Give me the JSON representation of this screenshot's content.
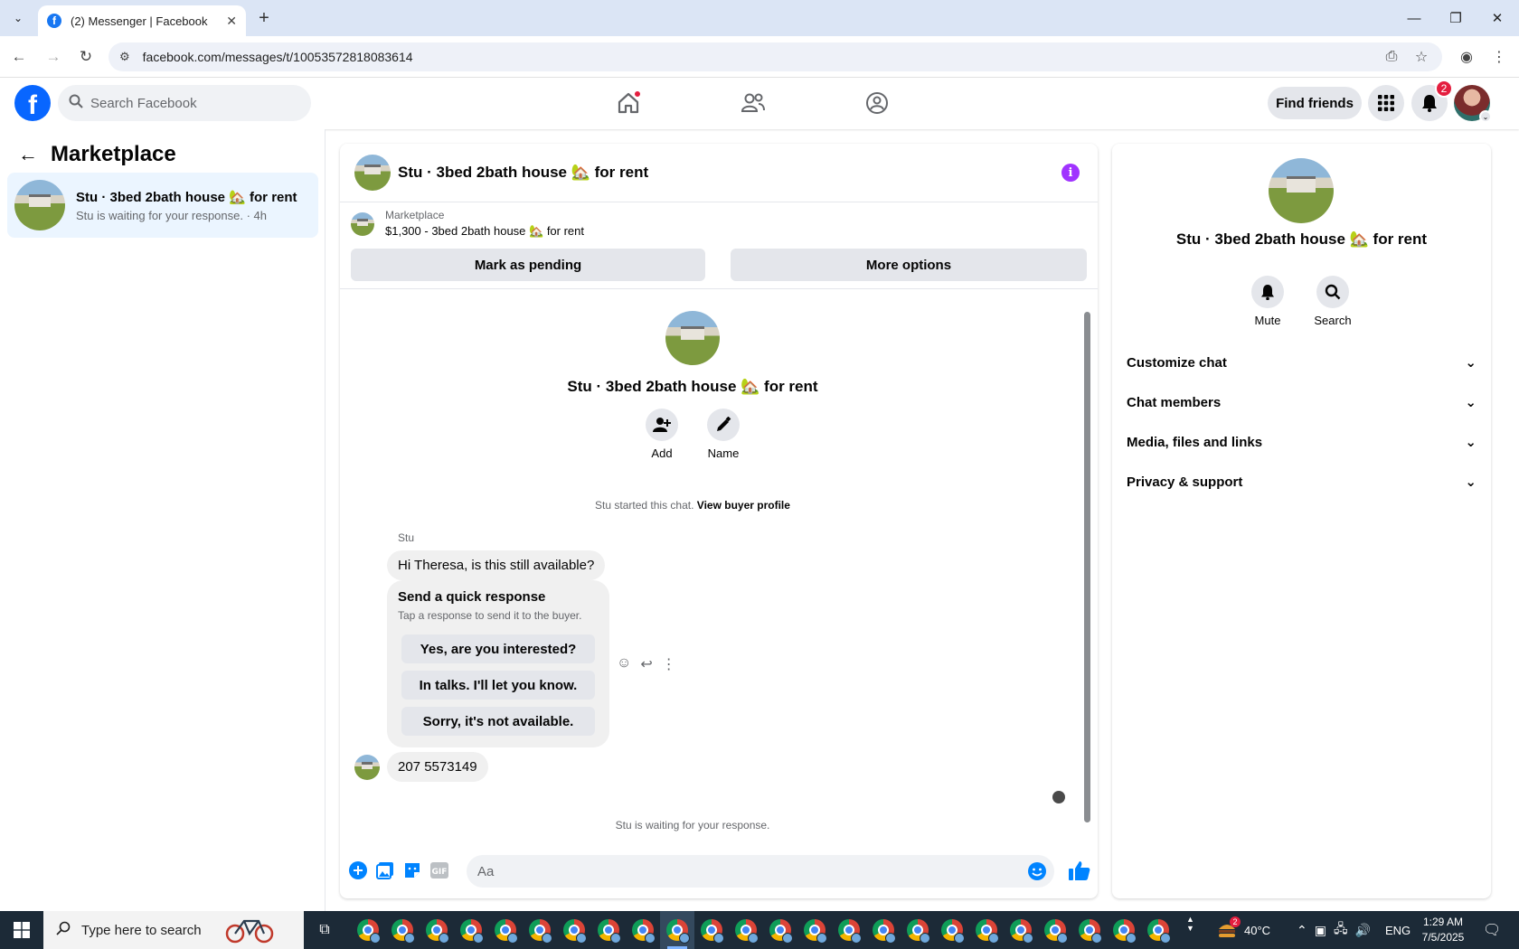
{
  "browser": {
    "tab_title": "(2) Messenger | Facebook",
    "url": "facebook.com/messages/t/10053572818083614"
  },
  "fb_header": {
    "search_placeholder": "Search Facebook",
    "find_friends_label": "Find friends",
    "notification_count": "2"
  },
  "left_pane": {
    "title": "Marketplace",
    "conversation": {
      "name": "Stu · 3bed 2bath house 🏡 for rent",
      "preview": "Stu is waiting for your response. · 4h"
    }
  },
  "chat": {
    "header_title": "Stu · 3bed 2bath house 🏡 for rent",
    "listing_label": "Marketplace",
    "listing_title": "$1,300 - 3bed 2bath house 🏡 for rent",
    "mark_pending_label": "Mark as pending",
    "more_options_label": "More options",
    "profile_name": "Stu · 3bed 2bath house 🏡 for rent",
    "add_label": "Add",
    "name_label": "Name",
    "started_text": "Stu started this chat.",
    "view_buyer_profile": "View buyer profile",
    "sender_name": "Stu",
    "message_1": "Hi Theresa, is this still available?",
    "quick_response_title": "Send a quick response",
    "quick_response_sub": "Tap a response to send it to the buyer.",
    "quick_responses": [
      "Yes, are you interested?",
      "In talks. I'll let you know.",
      "Sorry, it's not available."
    ],
    "message_2": "207 5573149",
    "waiting_text": "Stu is waiting for your response.",
    "composer_placeholder": "Aa"
  },
  "right_pane": {
    "name": "Stu · 3bed 2bath house 🏡 for rent",
    "mute_label": "Mute",
    "search_label": "Search",
    "sections": [
      "Customize chat",
      "Chat members",
      "Media, files and links",
      "Privacy & support"
    ]
  },
  "taskbar": {
    "search_placeholder": "Type here to search",
    "weather_badge": "2",
    "temperature": "40°C",
    "language": "ENG",
    "time": "1:29 AM",
    "date": "7/5/2025"
  },
  "colors": {
    "fb_blue": "#0866ff",
    "messenger_blue": "#0084ff",
    "info_purple": "#a033ff",
    "badge_red": "#e41e3f",
    "selected_conv_bg": "#ebf5ff"
  }
}
